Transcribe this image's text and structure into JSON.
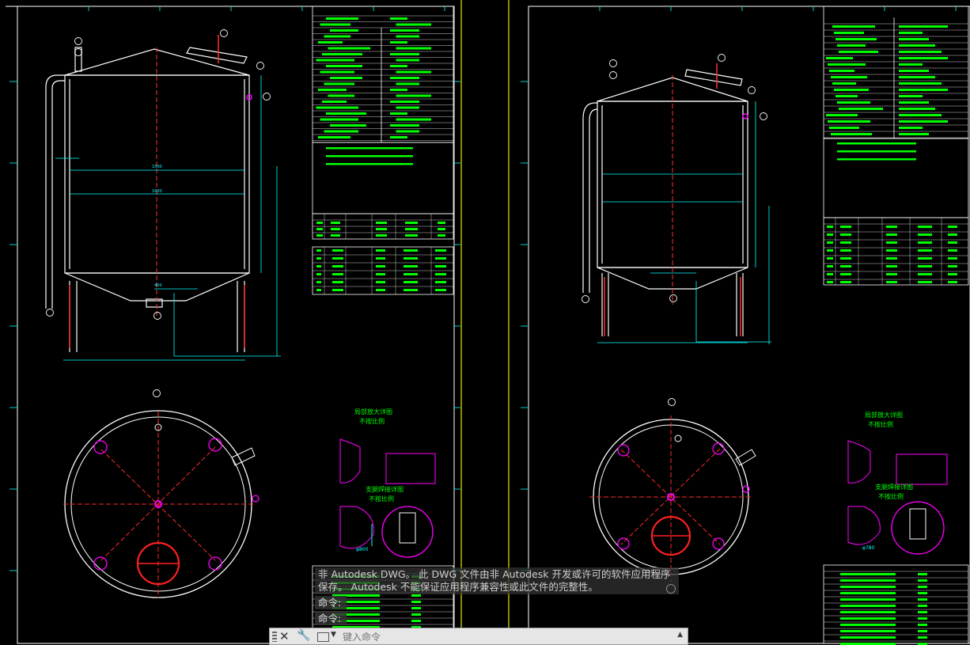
{
  "message": {
    "line1": "非 Autodesk DWG。 此 DWG 文件由非 Autodesk 开发或许可的软件应用程序",
    "line2": "保存。  Autodesk 不能保证应用程序兼容性或此文件的完整性。"
  },
  "command_history": [
    "命令:",
    "命令:"
  ],
  "command_line": {
    "placeholder": "键入命令"
  },
  "drawing": {
    "details_title": "局部放大详图",
    "details_scale": "不按比例",
    "support_title": "支腿焊接详图",
    "support_scale": "不按比例",
    "dim_center": "φ800",
    "dim_inner": "φ780"
  },
  "colors": {
    "lines": "#ffffff",
    "center": "#ff2020",
    "dims": "#00ffff",
    "table": "#00ff00",
    "accent": "#ff00ff",
    "border": "#ffff00"
  }
}
